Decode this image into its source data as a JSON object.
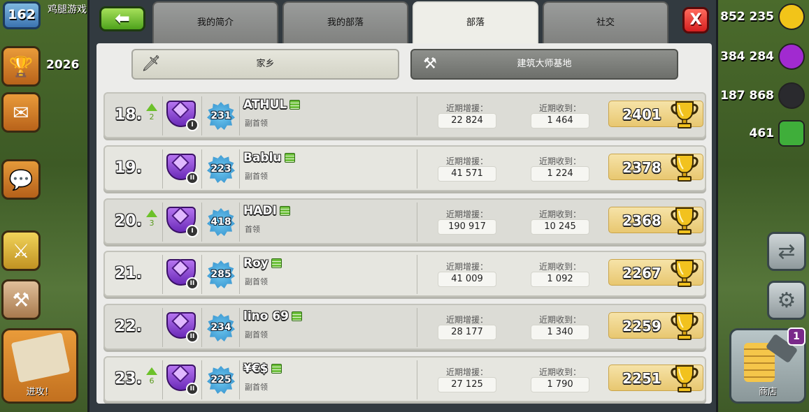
{
  "hud": {
    "player_level": "162",
    "player_name": "鸡腿游戏",
    "trophies": "2026",
    "attack_label": "进攻！",
    "shop_label": "商店",
    "shop_badge": "1",
    "resources": [
      {
        "name": "gold",
        "value": "852 235",
        "color": "#f2c419"
      },
      {
        "name": "elixir",
        "value": "384 284",
        "color": "#a12ad0"
      },
      {
        "name": "dark-elixir",
        "value": "187 868",
        "color": "#2a2a2e"
      },
      {
        "name": "gems",
        "value": "461",
        "color": "#3fae3a"
      }
    ]
  },
  "tabs": [
    {
      "label": "我的简介",
      "active": false
    },
    {
      "label": "我的部落",
      "active": false
    },
    {
      "label": "部落",
      "active": true
    },
    {
      "label": "社交",
      "active": false
    }
  ],
  "close_label": "X",
  "sub_tabs": {
    "home": {
      "label": "家乡",
      "icon": "sword-icon"
    },
    "builder": {
      "label": "建筑大师基地",
      "icon": "crossed-axes-icon"
    }
  },
  "columns": {
    "donated_label": "近期增援：",
    "received_label": "近期收到："
  },
  "members": [
    {
      "rank": "18.",
      "change": "2",
      "league_tier": "I",
      "exp": "231",
      "name": "ATHUL",
      "role": "副首领",
      "donated": "22 824",
      "received": "1 464",
      "trophies": "2401"
    },
    {
      "rank": "19.",
      "change": "",
      "league_tier": "II",
      "exp": "223",
      "name": "Bablu",
      "role": "副首领",
      "donated": "41 571",
      "received": "1 224",
      "trophies": "2378"
    },
    {
      "rank": "20.",
      "change": "3",
      "league_tier": "I",
      "exp": "418",
      "name": "HADI",
      "role": "首领",
      "donated": "190 917",
      "received": "10 245",
      "trophies": "2368"
    },
    {
      "rank": "21.",
      "change": "",
      "league_tier": "II",
      "exp": "285",
      "name": "Roy",
      "role": "副首领",
      "donated": "41 009",
      "received": "1 092",
      "trophies": "2267"
    },
    {
      "rank": "22.",
      "change": "",
      "league_tier": "II",
      "exp": "234",
      "name": "lino 69",
      "role": "副首领",
      "donated": "28 177",
      "received": "1 340",
      "trophies": "2259"
    },
    {
      "rank": "23.",
      "change": "6",
      "league_tier": "II",
      "exp": "225",
      "name": "¥€$",
      "role": "副首领",
      "donated": "27 125",
      "received": "1 790",
      "trophies": "2251"
    }
  ]
}
